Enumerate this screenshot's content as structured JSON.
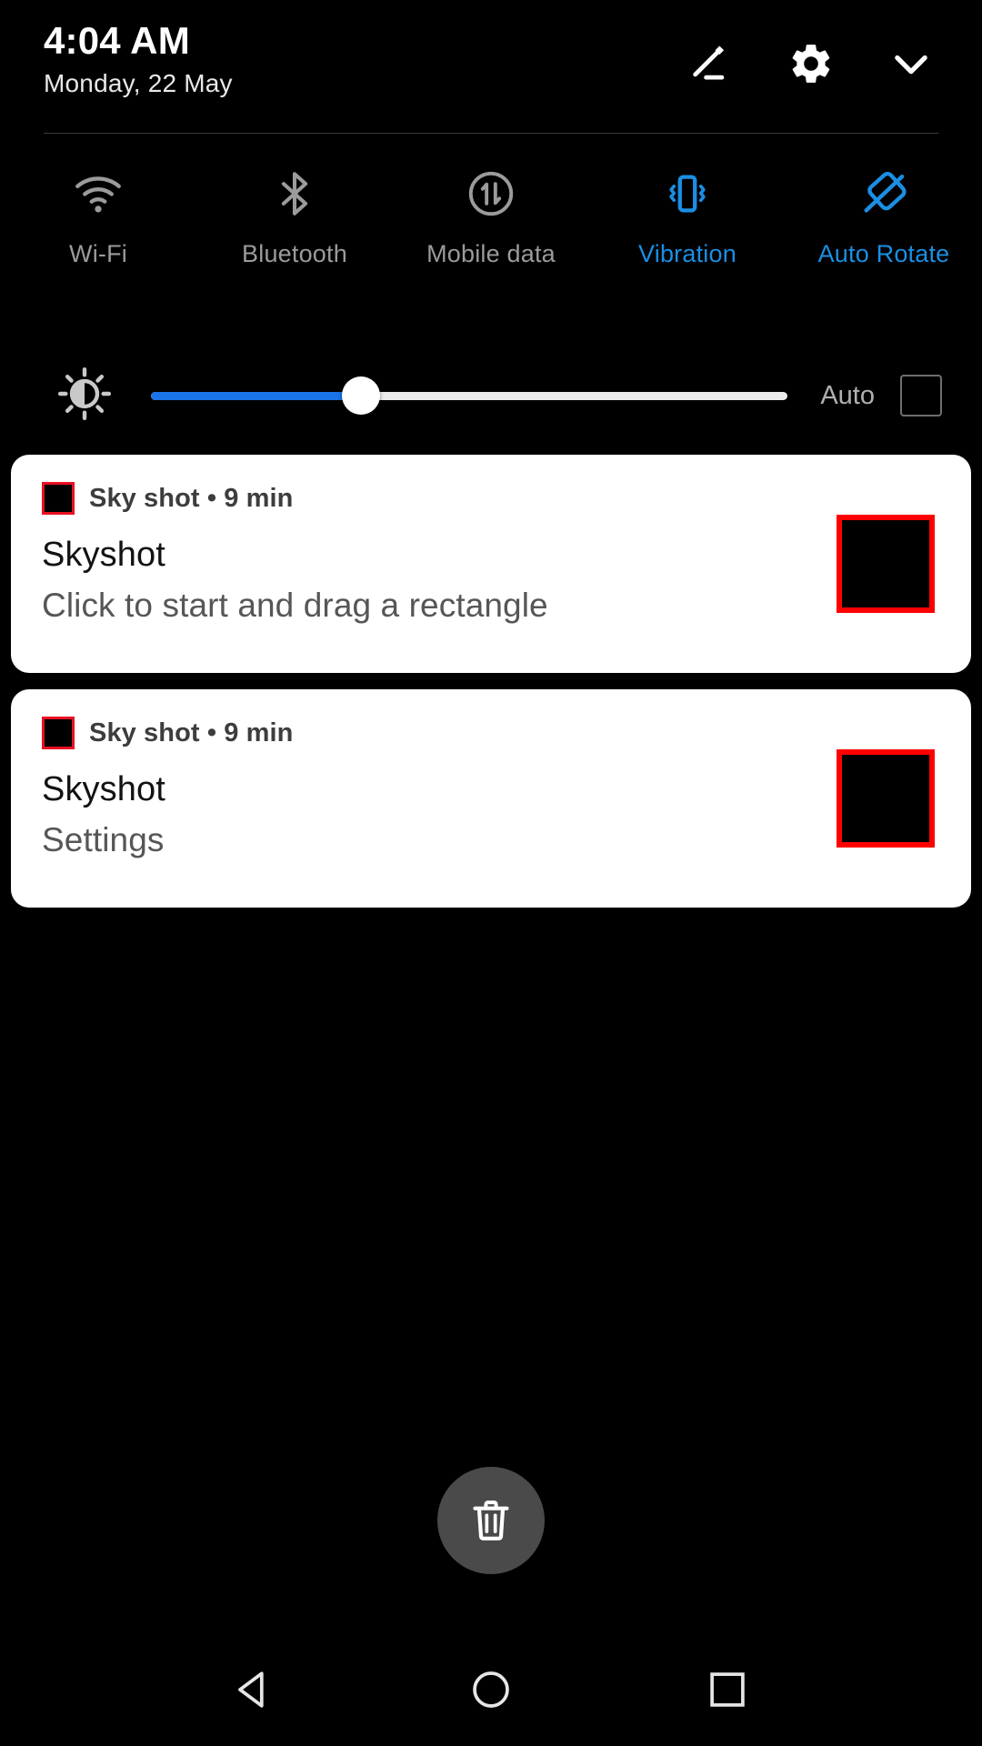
{
  "statusbar": {
    "time": "4:04 AM",
    "date": "Monday, 22 May",
    "icons": {
      "edit": "pencil-edit-icon",
      "settings": "gear-icon",
      "collapse": "chevron-down-icon"
    }
  },
  "quick_settings": {
    "tiles": [
      {
        "label": "Wi-Fi",
        "icon": "wifi-icon",
        "active": false
      },
      {
        "label": "Bluetooth",
        "icon": "bluetooth-icon",
        "active": false
      },
      {
        "label": "Mobile data",
        "icon": "mobile-data-icon",
        "active": false
      },
      {
        "label": "Vibration",
        "icon": "vibration-icon",
        "active": true
      },
      {
        "label": "Auto Rotate",
        "icon": "auto-rotate-icon",
        "active": true
      }
    ],
    "colors": {
      "active": "#1a8fe3",
      "inactive": "#9b9b9b"
    }
  },
  "brightness": {
    "icon": "brightness-sun-icon",
    "value_percent": 33,
    "fill_color": "#1a73e8",
    "track_color": "#ececec",
    "auto_label": "Auto",
    "auto_checked": false
  },
  "notifications": [
    {
      "app_name": "Sky shot",
      "separator": "•",
      "time": "9 min",
      "title": "Skyshot",
      "body": "Click to start and drag a rectangle",
      "icon_border_color": "#e81123",
      "thumbnail_border_color": "#ff0000"
    },
    {
      "app_name": "Sky shot",
      "separator": "•",
      "time": "9 min",
      "title": "Skyshot",
      "body": "Settings",
      "icon_border_color": "#e81123",
      "thumbnail_border_color": "#ff0000"
    }
  ],
  "clear_all": {
    "icon": "trash-icon",
    "background": "#4a4a4a"
  },
  "navbar": {
    "back": "back-triangle-icon",
    "home": "home-circle-icon",
    "recents": "recents-square-icon"
  }
}
